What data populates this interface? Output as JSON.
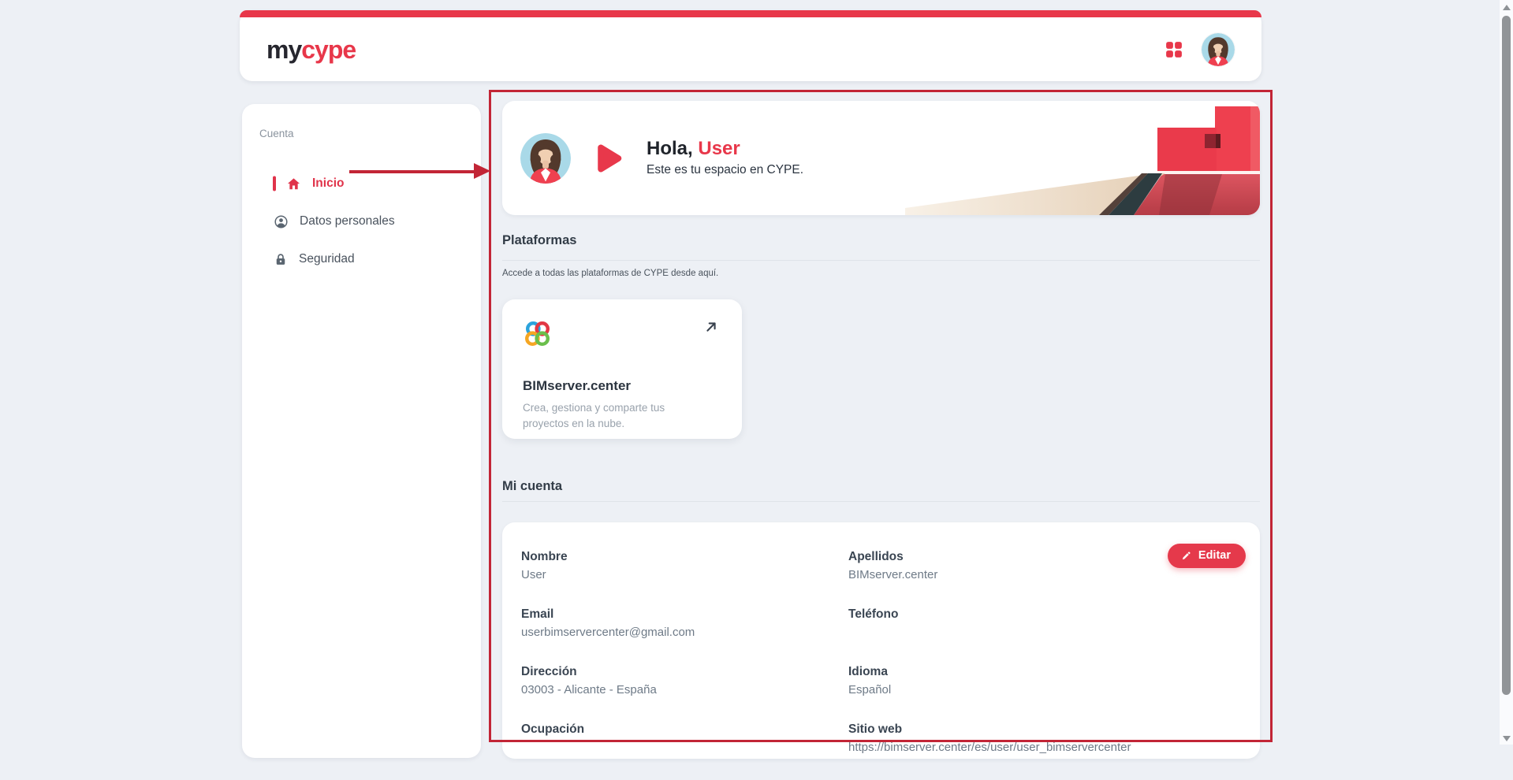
{
  "colors": {
    "brand_red": "#e8374a",
    "annotation_red": "#c22536",
    "page_background": "#edf0f5",
    "card_background": "#ffffff",
    "active_item_red": "#e0334a",
    "heading_text": "#323c47",
    "muted_text": "#6e7a87"
  },
  "header": {
    "logo_prefix": "my",
    "logo_suffix": "cype"
  },
  "icons": {
    "header": [
      "apps-grid-icon",
      "user-avatar"
    ],
    "sidebar": [
      "home-icon",
      "person-circle-icon",
      "lock-icon"
    ],
    "content": [
      "play-icon",
      "bimserver-logo",
      "external-link-icon",
      "pencil-icon"
    ]
  },
  "sidebar": {
    "section_label": "Cuenta",
    "items": [
      {
        "label": "Inicio",
        "icon": "home",
        "active": true
      },
      {
        "label": "Datos personales",
        "icon": "person-circle",
        "active": false
      },
      {
        "label": "Seguridad",
        "icon": "lock",
        "active": false
      }
    ]
  },
  "hero": {
    "greeting_prefix": "Hola,",
    "greeting_name": "User",
    "subtitle": "Este es tu espacio en CYPE."
  },
  "platforms": {
    "title": "Plataformas",
    "description": "Accede a todas las plataformas de CYPE desde aquí.",
    "cards": [
      {
        "name": "BIMserver.center",
        "description": "Crea, gestiona y comparte tus proyectos en la nube."
      }
    ]
  },
  "account": {
    "title": "Mi cuenta",
    "edit_button": "Editar",
    "fields": [
      {
        "label": "Nombre",
        "value": "User"
      },
      {
        "label": "Apellidos",
        "value": "BIMserver.center"
      },
      {
        "label": "Email",
        "value": "userbimservercenter@gmail.com"
      },
      {
        "label": "Teléfono",
        "value": ""
      },
      {
        "label": "Dirección",
        "value": "03003 - Alicante - España"
      },
      {
        "label": "Idioma",
        "value": "Español"
      },
      {
        "label": "Ocupación",
        "value": ""
      },
      {
        "label": "Sitio web",
        "value": "https://bimserver.center/es/user/user_bimservercenter"
      }
    ]
  }
}
